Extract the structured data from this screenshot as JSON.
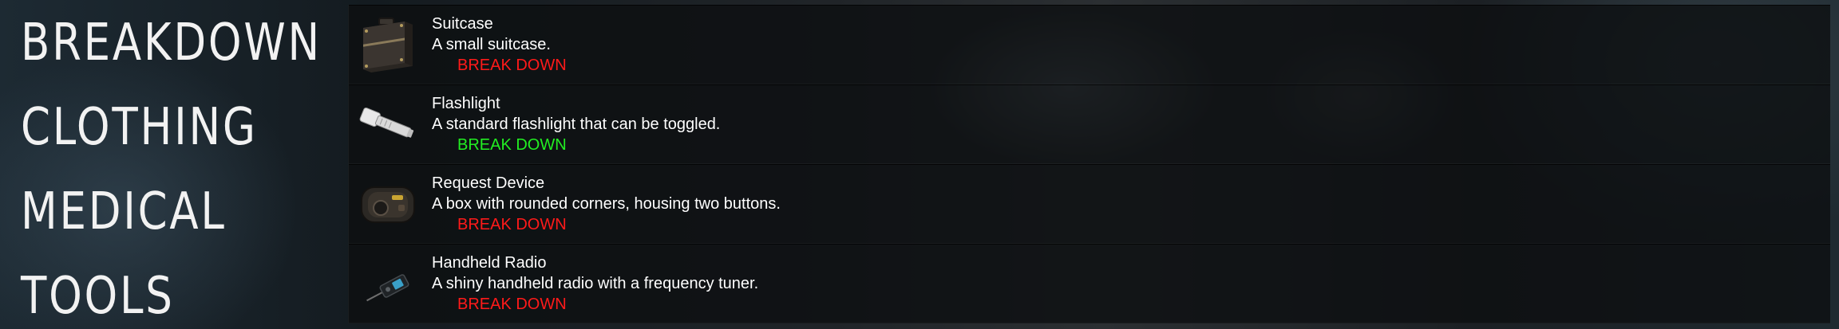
{
  "categories": [
    "BREAKDOWN",
    "CLOTHING",
    "MEDICAL",
    "TOOLS"
  ],
  "items": [
    {
      "name": "Suitcase",
      "description": "A small suitcase.",
      "action": "BREAK DOWN",
      "action_state": "disabled",
      "icon": "suitcase-icon"
    },
    {
      "name": "Flashlight",
      "description": "A standard flashlight that can be toggled.",
      "action": "BREAK DOWN",
      "action_state": "enabled",
      "icon": "flashlight-icon"
    },
    {
      "name": "Request Device",
      "description": "A box with rounded corners, housing two buttons.",
      "action": "BREAK DOWN",
      "action_state": "disabled",
      "icon": "request-device-icon"
    },
    {
      "name": "Handheld Radio",
      "description": "A shiny handheld radio with a frequency tuner.",
      "action": "BREAK DOWN",
      "action_state": "disabled",
      "icon": "handheld-radio-icon"
    }
  ],
  "colors": {
    "action_disabled": "#ff1a1a",
    "action_enabled": "#22ee22",
    "text": "#ffffff"
  }
}
